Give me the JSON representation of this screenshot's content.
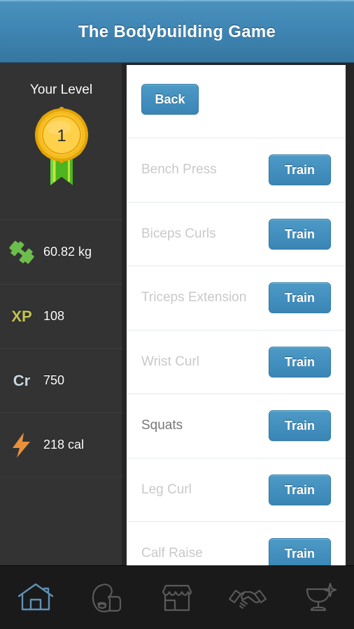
{
  "header": {
    "title": "The Bodybuilding Game"
  },
  "sidebar": {
    "level_label": "Your Level",
    "level_value": "1",
    "stats": [
      {
        "icon": "dumbbell-icon",
        "glyph": "",
        "value": "60.82 kg"
      },
      {
        "icon": "xp-icon",
        "glyph": "XP",
        "value": "108"
      },
      {
        "icon": "credits-icon",
        "glyph": "Cr",
        "value": "750"
      },
      {
        "icon": "energy-bolt-icon",
        "glyph": "",
        "value": "218 cal"
      }
    ]
  },
  "main": {
    "back_label": "Back",
    "train_label": "Train",
    "exercises": [
      {
        "name": "Bench Press",
        "enabled": false
      },
      {
        "name": "Biceps Curls",
        "enabled": false
      },
      {
        "name": "Triceps Extension",
        "enabled": false
      },
      {
        "name": "Wrist Curl",
        "enabled": false
      },
      {
        "name": "Squats",
        "enabled": true
      },
      {
        "name": "Leg Curl",
        "enabled": false
      },
      {
        "name": "Calf Raise",
        "enabled": false
      }
    ]
  },
  "navbar": {
    "items": [
      {
        "icon": "home-icon",
        "active": true
      },
      {
        "icon": "muscle-arm-icon",
        "active": false
      },
      {
        "icon": "shop-icon",
        "active": false
      },
      {
        "icon": "handshake-icon",
        "active": false
      },
      {
        "icon": "trophy-cup-icon",
        "active": false
      }
    ]
  },
  "colors": {
    "accent_blue": "#4390bf",
    "header_blue": "#3f86b4",
    "sidebar_bg": "#333333",
    "nav_active": "#5f92b8",
    "nav_inactive": "#5a5a5a",
    "xp_yellow": "#c3c356",
    "credits_gray": "#c8d6dd",
    "dumbbell_green": "#6dbd4c",
    "bolt_orange": "#e8913a",
    "medal_gold": "#f2b91c",
    "ribbon_green": "#5cc22b"
  }
}
